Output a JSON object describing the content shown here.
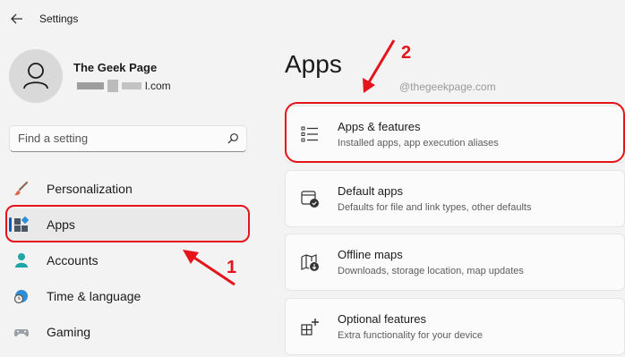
{
  "window": {
    "title": "Settings"
  },
  "profile": {
    "name": "The Geek Page",
    "email_suffix": "l.com"
  },
  "search": {
    "placeholder": "Find a setting"
  },
  "nav": {
    "items": [
      {
        "label": "Personalization",
        "icon": "brush-icon"
      },
      {
        "label": "Apps",
        "icon": "apps-icon",
        "selected": true
      },
      {
        "label": "Accounts",
        "icon": "person-icon"
      },
      {
        "label": "Time & language",
        "icon": "globe-clock-icon"
      },
      {
        "label": "Gaming",
        "icon": "gamepad-icon"
      }
    ]
  },
  "main": {
    "title": "Apps",
    "watermark": "@thegeekpage.com",
    "cards": [
      {
        "title": "Apps & features",
        "subtitle": "Installed apps, app execution aliases",
        "icon": "list-icon"
      },
      {
        "title": "Default apps",
        "subtitle": "Defaults for file and link types, other defaults",
        "icon": "default-apps-icon"
      },
      {
        "title": "Offline maps",
        "subtitle": "Downloads, storage location, map updates",
        "icon": "map-download-icon"
      },
      {
        "title": "Optional features",
        "subtitle": "Extra functionality for your device",
        "icon": "optional-features-icon"
      }
    ]
  },
  "annotations": {
    "marker1": "1",
    "marker2": "2",
    "color": "#e5141b"
  },
  "colors": {
    "accent": "#005fb8",
    "background": "#f3f3f3",
    "card": "#fbfbfb"
  }
}
